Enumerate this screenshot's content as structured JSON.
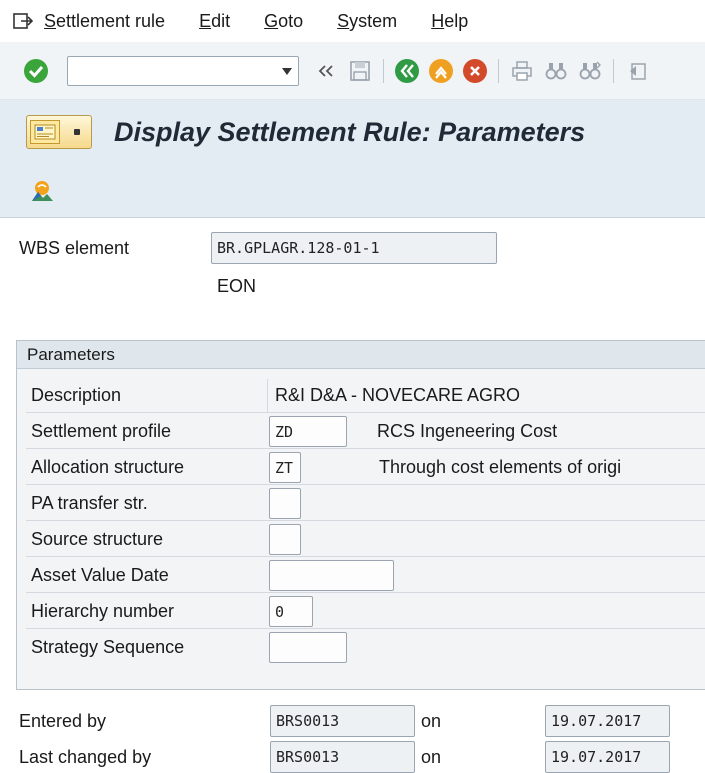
{
  "menu": {
    "items": [
      "Settlement rule",
      "Edit",
      "Goto",
      "System",
      "Help"
    ]
  },
  "toolbar": {
    "command_value": "",
    "icons": [
      "enter-icon",
      "back-icon",
      "save-icon",
      "exit-icon",
      "cancel-icon",
      "print-icon",
      "find-icon",
      "find-next-icon",
      "first-page-icon"
    ]
  },
  "title": {
    "text": "Display Settlement Rule: Parameters"
  },
  "header": {
    "wbs_label": "WBS element",
    "wbs_value": "BR.GPLAGR.128-01-1",
    "wbs_desc": "EON"
  },
  "parameters": {
    "group_title": "Parameters",
    "rows": [
      {
        "label": "Description",
        "value": "R&I D&A - NOVECARE AGRO",
        "desc": ""
      },
      {
        "label": "Settlement profile",
        "value": "ZD",
        "desc": "RCS Ingeneering Cost"
      },
      {
        "label": "Allocation structure",
        "value": "ZT",
        "desc": "Through cost elements of origi"
      },
      {
        "label": "PA transfer str.",
        "value": "",
        "desc": ""
      },
      {
        "label": "Source structure",
        "value": "",
        "desc": ""
      },
      {
        "label": "Asset Value Date",
        "value": "",
        "desc": ""
      },
      {
        "label": "Hierarchy number",
        "value": "0",
        "desc": ""
      },
      {
        "label": "Strategy Sequence",
        "value": "",
        "desc": ""
      }
    ]
  },
  "footer": {
    "entered_label": "Entered by",
    "entered_user": "BRS0013",
    "entered_on_label": "on",
    "entered_date": "19.07.2017",
    "changed_label": "Last changed by",
    "changed_user": "BRS0013",
    "changed_on_label": "on",
    "changed_date": "19.07.2017"
  },
  "colors": {
    "title_bg": "#e3ecf3",
    "toolbar_bg": "#f1f4f7",
    "enter_green": "#3aa53a",
    "back_green": "#2f9b44",
    "exit_orange": "#f0a020",
    "cancel_red": "#d24a2a"
  }
}
